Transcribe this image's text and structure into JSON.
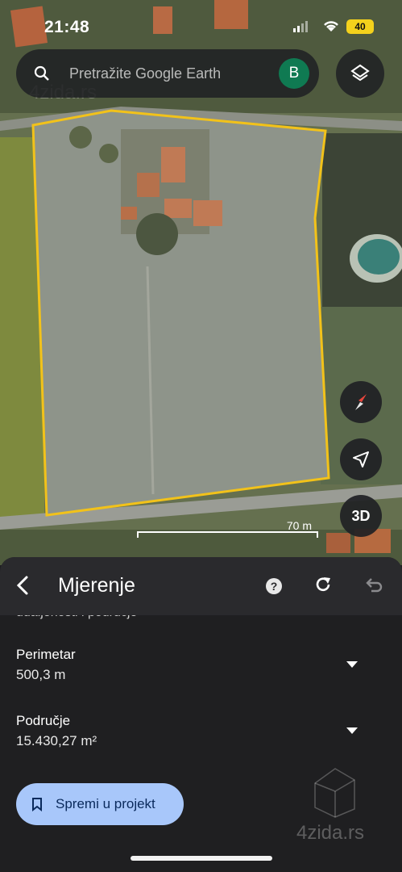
{
  "status_bar": {
    "time": "21:48",
    "battery": "40"
  },
  "search": {
    "placeholder": "Pretražite Google Earth",
    "avatar_letter": "B"
  },
  "map": {
    "watermark": "4zida.rs",
    "scale_label": "70 m",
    "threed_label": "3D",
    "outline_color": "#f2c21a"
  },
  "panel": {
    "title": "Mjerenje",
    "help_symbol": "?",
    "partial_text": "udaljenosti i područje",
    "perimeter": {
      "label": "Perimetar",
      "value": "500,3 m"
    },
    "area": {
      "label": "Područje",
      "value": "15.430,27 m²"
    },
    "save_button": "Spremi u projekt",
    "watermark": "4zida.rs"
  },
  "icons": [
    "search-icon",
    "layers-icon",
    "compass-icon",
    "navigation-arrow-icon",
    "back-arrow-icon",
    "help-icon",
    "redo-icon",
    "undo-icon",
    "bookmark-icon",
    "chevron-down-icon"
  ]
}
